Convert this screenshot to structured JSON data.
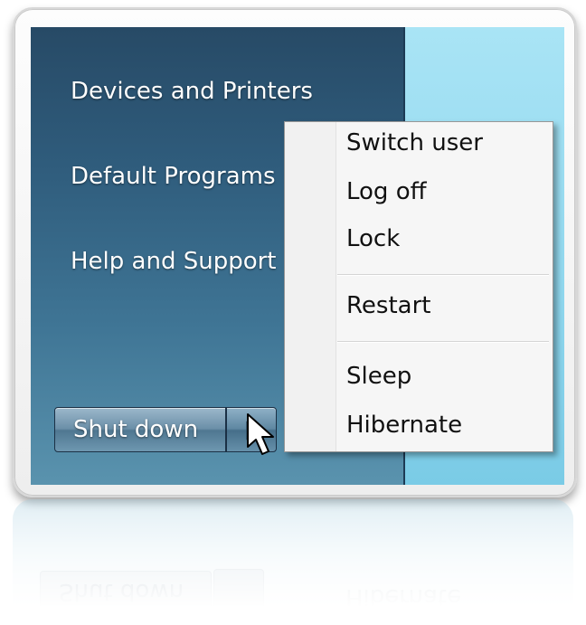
{
  "start_menu": {
    "links": [
      {
        "label": "Devices and Printers"
      },
      {
        "label": "Default Programs"
      },
      {
        "label": "Help and Support"
      }
    ],
    "shutdown_label": "Shut down"
  },
  "power_menu": {
    "items": [
      {
        "label": "Switch user"
      },
      {
        "label": "Log off"
      },
      {
        "label": "Lock"
      },
      {
        "label": "Restart"
      },
      {
        "label": "Sleep"
      },
      {
        "label": "Hibernate"
      }
    ]
  },
  "reflection": {
    "shutdown_label": "Shut down",
    "item_label": "Hibernate"
  },
  "colors": {
    "left_pane": "#2f5c7c",
    "right_pane": "#a9e4f5",
    "menu_bg": "#f6f6f6"
  },
  "icons": {
    "arrow": "triangle-right-icon",
    "cursor": "mouse-pointer-icon"
  }
}
